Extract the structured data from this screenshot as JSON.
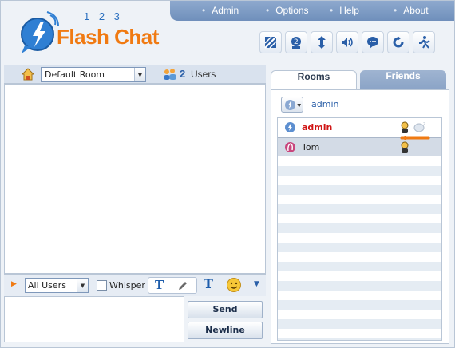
{
  "app": {
    "logo_digits": "1 2 3",
    "logo_text": "Flash Chat"
  },
  "menu": [
    "Admin",
    "Options",
    "Help",
    "About"
  ],
  "toolbar_icons": [
    "skin-icon",
    "avatar-icon",
    "resize-icon",
    "sound-icon",
    "bubble-icon",
    "refresh-icon",
    "exit-icon"
  ],
  "room": {
    "selected": "Default Room",
    "user_count": "2",
    "users_label": "Users"
  },
  "compose": {
    "recipient": "All Users",
    "whisper_label": "Whisper",
    "send_label": "Send",
    "newline_label": "Newline",
    "text_format_glyph": "T"
  },
  "tabs": [
    "Rooms",
    "Friends"
  ],
  "current_user": "admin",
  "users": [
    {
      "name": "admin",
      "role": "admin",
      "name_color": "#d01515"
    },
    {
      "name": "Tom",
      "role": "user",
      "name_color": "#222222"
    }
  ],
  "colors": {
    "brand_orange": "#f07a12",
    "brand_blue": "#2a6fbf",
    "menubar": "#7f9cc5",
    "admin_red": "#d01515"
  }
}
